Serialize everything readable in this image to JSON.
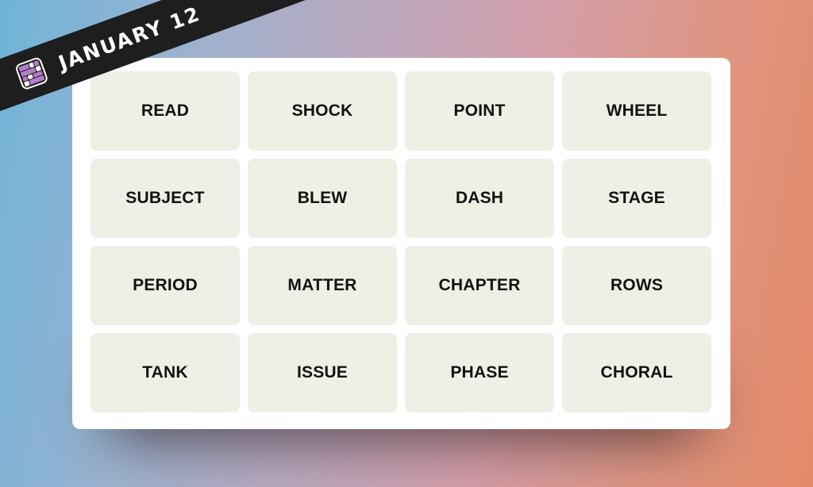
{
  "banner": {
    "date_label": "JANUARY 12",
    "icon": "connections-grid-icon",
    "icon_colors": {
      "purple": "#b27ec9",
      "white": "#ffffff",
      "frame": "#1e1e1e"
    }
  },
  "board": {
    "tile_color": "#efefe6",
    "text_color": "#121212",
    "rows": [
      [
        "READ",
        "SHOCK",
        "POINT",
        "WHEEL"
      ],
      [
        "SUBJECT",
        "BLEW",
        "DASH",
        "STAGE"
      ],
      [
        "PERIOD",
        "MATTER",
        "CHAPTER",
        "ROWS"
      ],
      [
        "TANK",
        "ISSUE",
        "PHASE",
        "CHORAL"
      ]
    ]
  }
}
